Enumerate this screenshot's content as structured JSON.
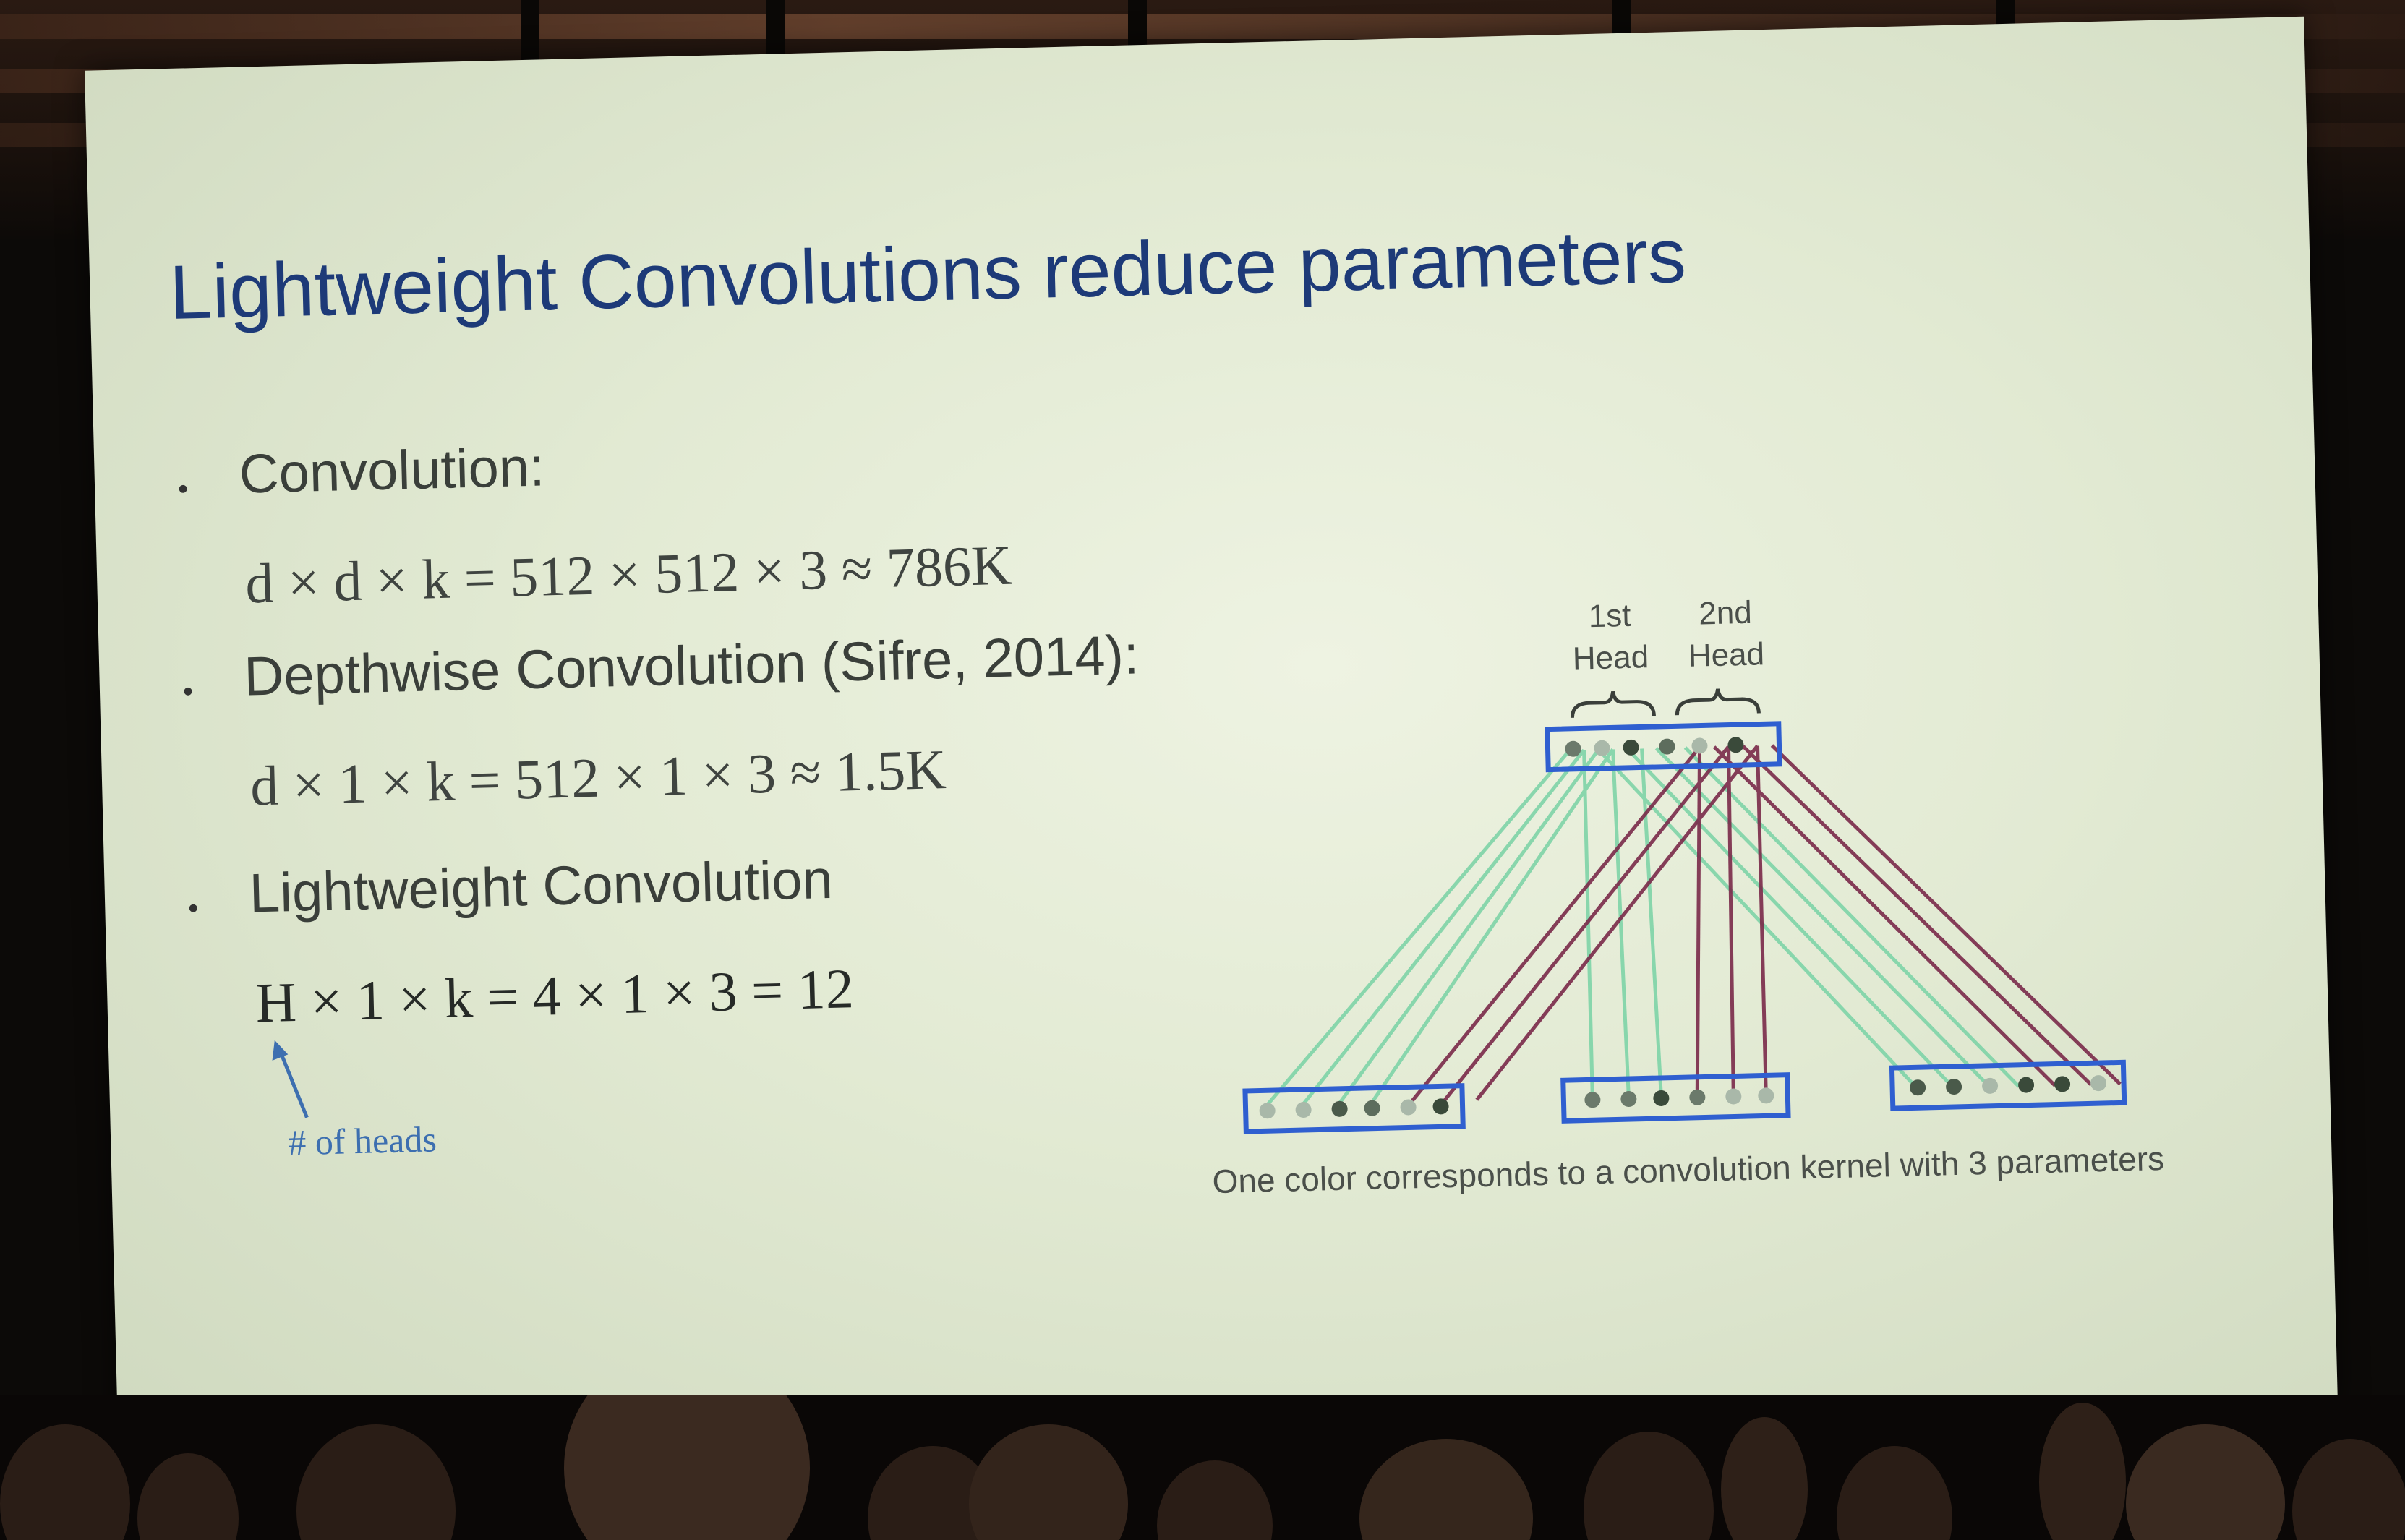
{
  "slide": {
    "title": "Lightweight Convolutions reduce parameters",
    "bullets": [
      {
        "label": "Convolution:",
        "formula": "d × d × k = 512 × 512 × 3 ≈ 786K"
      },
      {
        "label": "Depthwise Convolution (Sifre, 2014):",
        "formula": "d × 1 × k = 512 × 1 × 3 ≈ 1.5K"
      },
      {
        "label": "Lightweight Convolution",
        "formula": "H × 1 × k = 4 × 1 × 3 = 12"
      }
    ],
    "annotation": "# of heads",
    "diagram": {
      "head_labels": [
        {
          "line1": "1st",
          "line2": "Head"
        },
        {
          "line1": "2nd",
          "line2": "Head"
        }
      ],
      "caption": "One color corresponds to a convolution kernel with 3 parameters"
    }
  },
  "colors": {
    "title": "#1d3a78",
    "annotation": "#3d6fb0",
    "box_outline": "#2f5fd0",
    "green_kernel": "#7fd4a8",
    "purple_kernel": "#7a2a4a"
  }
}
